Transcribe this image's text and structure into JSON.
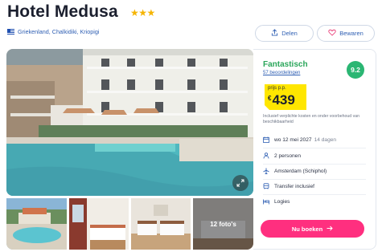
{
  "hotel": {
    "name": "Hotel Medusa",
    "stars": "★★★",
    "location": "Griekenland, Chalkidiki, Kriopigi"
  },
  "actions": {
    "share_label": "Delen",
    "save_label": "Bewaren"
  },
  "gallery": {
    "more_photos_label": "12 foto's"
  },
  "rating": {
    "label": "Fantastisch",
    "score": "9.2",
    "reviews": "57 beoordelingen"
  },
  "price": {
    "label": "prijs p.p.",
    "currency": "€",
    "amount": "439",
    "note": "Inclusief verplichte kosten en onder voorbehoud van beschikbaarheid"
  },
  "details": {
    "date": "wo 12 mei 2027",
    "duration": "14 dagen",
    "persons": "2 personen",
    "departure": "Amsterdam (Schiphol)",
    "transfer": "Transfer inclusief",
    "board": "Logies"
  },
  "cta": {
    "book_label": "Nu boeken"
  },
  "colors": {
    "accent_blue": "#2f5fb3",
    "rating_green": "#2bb673",
    "price_yellow": "#ffe600",
    "cta_pink": "#ff2f7f",
    "stars_gold": "#f5b400"
  },
  "icons": [
    "flag-greece-icon",
    "share-icon",
    "heart-icon",
    "expand-icon",
    "calendar-icon",
    "persons-icon",
    "plane-icon",
    "bus-icon",
    "bed-icon",
    "arrow-right-icon"
  ]
}
